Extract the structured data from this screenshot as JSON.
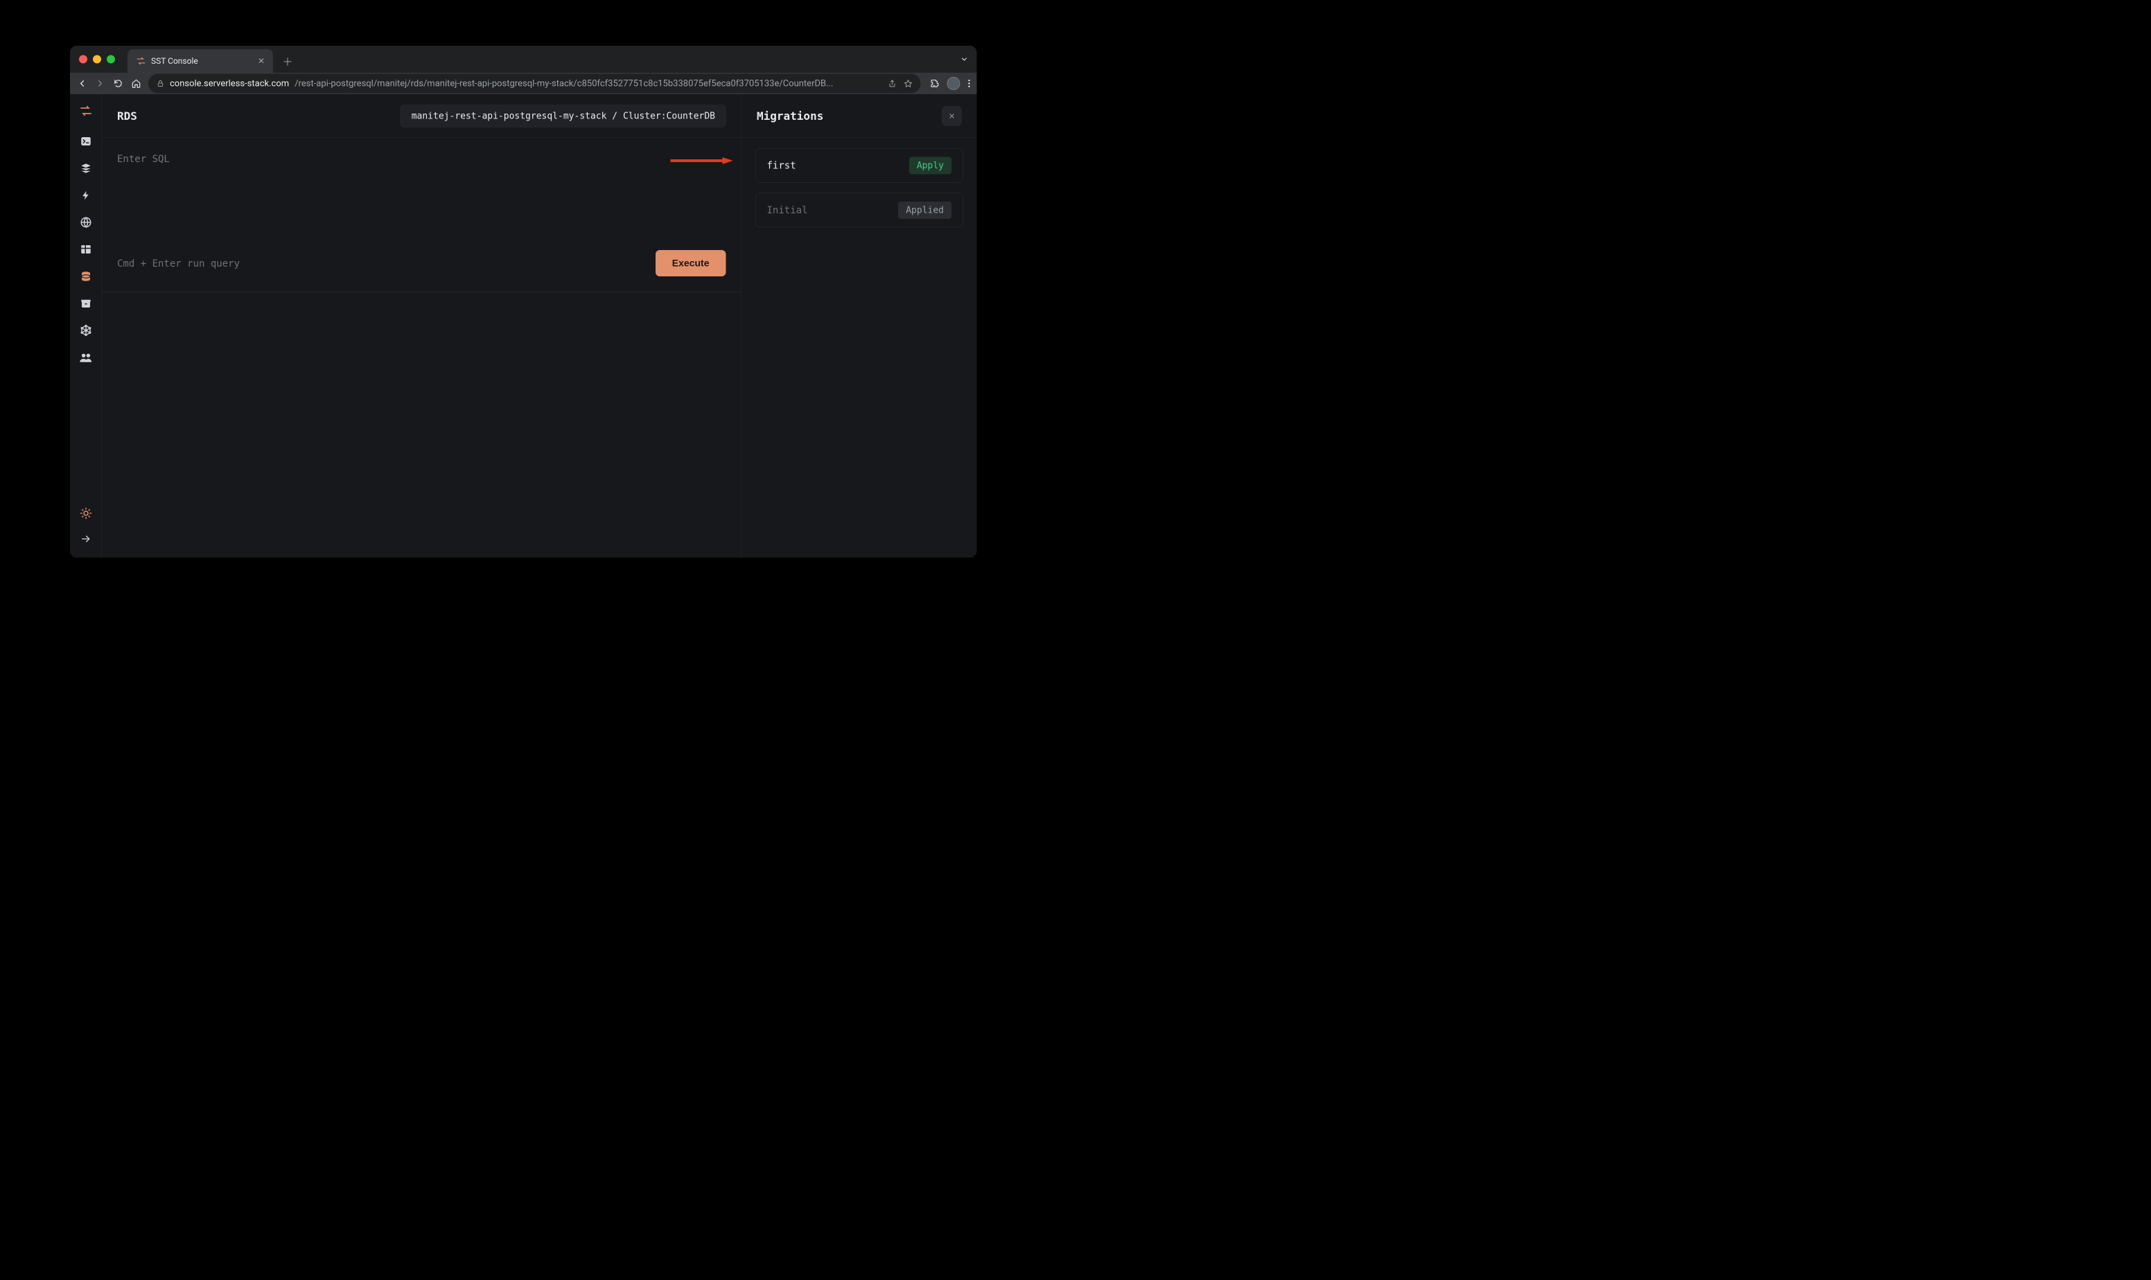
{
  "browser": {
    "tab_title": "SST Console",
    "url_host": "console.serverless-stack.com",
    "url_rest": "/rest-api-postgresql/manitej/rds/manitej-rest-api-postgresql-my-stack/c850fcf3527751c8c15b338075ef5eca0f3705133e/CounterDB..."
  },
  "sidebar": {
    "items": [
      {
        "name": "logo",
        "label": "SST"
      },
      {
        "name": "terminal",
        "label": "Local"
      },
      {
        "name": "stacks",
        "label": "Stacks"
      },
      {
        "name": "functions",
        "label": "Functions"
      },
      {
        "name": "api",
        "label": "API"
      },
      {
        "name": "tables",
        "label": "Tables"
      },
      {
        "name": "rds",
        "label": "RDS"
      },
      {
        "name": "buckets",
        "label": "Buckets"
      },
      {
        "name": "graphql",
        "label": "GraphQL"
      },
      {
        "name": "cognito",
        "label": "Cognito"
      }
    ]
  },
  "page": {
    "title": "RDS",
    "context": "manitej-rest-api-postgresql-my-stack / Cluster:CounterDB",
    "sql_placeholder": "Enter SQL",
    "hint": "Cmd + Enter run query",
    "execute_label": "Execute"
  },
  "migrations": {
    "title": "Migrations",
    "items": [
      {
        "name": "first",
        "status_label": "Apply",
        "applied": false
      },
      {
        "name": "Initial",
        "status_label": "Applied",
        "applied": true
      }
    ]
  }
}
